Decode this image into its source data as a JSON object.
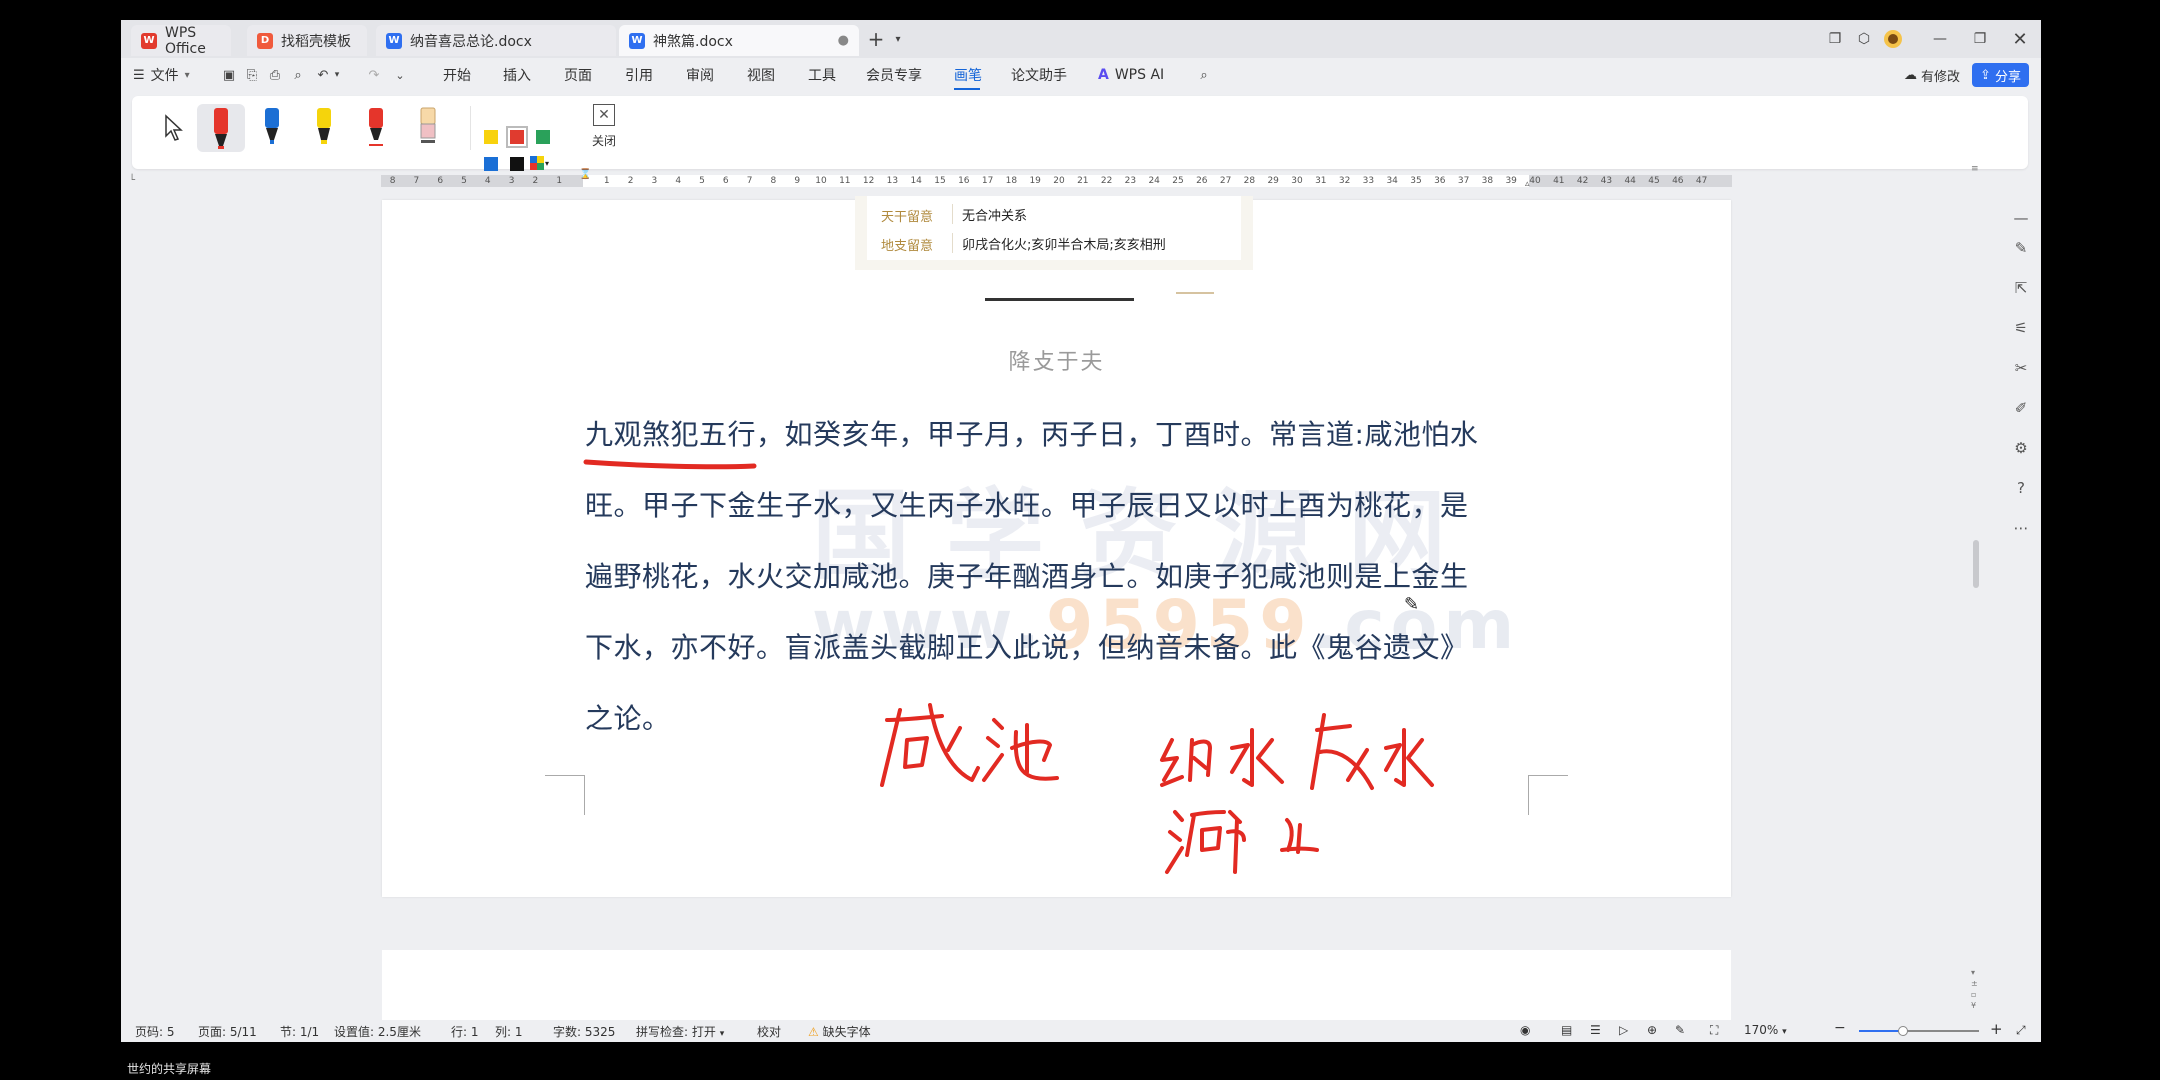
{
  "tabs": [
    {
      "label": "WPS Office",
      "icon": "wps-logo-icon"
    },
    {
      "label": "找稻壳模板",
      "icon": "docer-icon"
    },
    {
      "label": "纳音喜忌总论.docx",
      "icon": "word-doc-icon"
    },
    {
      "label": "神煞篇.docx",
      "icon": "word-doc-icon"
    }
  ],
  "menu": {
    "file": "文件",
    "items": [
      "开始",
      "插入",
      "页面",
      "引用",
      "审阅",
      "视图",
      "工具",
      "会员专享",
      "画笔",
      "论文助手",
      "WPS AI"
    ],
    "active": "画笔",
    "modify": "有修改",
    "share": "分享"
  },
  "pen_toolbar": {
    "close_label": "关闭",
    "colors": [
      "#f8d20d",
      "#e03b2f",
      "#2aa15a",
      "#1a6fd6",
      "#111111"
    ],
    "pens": [
      {
        "name": "red-marker",
        "color": "#e5352b"
      },
      {
        "name": "blue-pen",
        "color": "#1c6fd4"
      },
      {
        "name": "yellow-highlighter",
        "color": "#f5d40c"
      },
      {
        "name": "red-pen",
        "color": "#e5352b"
      },
      {
        "name": "eraser",
        "color": "#f0c0c4"
      }
    ]
  },
  "ruler": {
    "left": [
      "8",
      "7",
      "6",
      "5",
      "4",
      "3",
      "2",
      "1"
    ],
    "right": [
      "1",
      "2",
      "3",
      "4",
      "5",
      "6",
      "7",
      "8",
      "9",
      "10",
      "11",
      "12",
      "13",
      "14",
      "15",
      "16",
      "17",
      "18",
      "19",
      "20",
      "21",
      "22",
      "23",
      "24",
      "25",
      "26",
      "27",
      "28",
      "29",
      "30",
      "31",
      "32",
      "33",
      "34",
      "35",
      "36",
      "37",
      "38",
      "39",
      "40",
      "41",
      "42",
      "43",
      "44",
      "45",
      "46",
      "47"
    ]
  },
  "info_card": {
    "rows": [
      {
        "key": "天干留意",
        "value": "无合冲关系"
      },
      {
        "key": "地支留意",
        "value": "卯戌合化火;亥卯半合木局;亥亥相刑"
      }
    ]
  },
  "document": {
    "chapter_title": "降攴于夫",
    "lines": [
      "九观煞犯五行，如癸亥年，甲子月，丙子日，丁酉时。常言道:咸池怕水",
      "旺。甲子下金生子水，又生丙子水旺。甲子辰日又以时上酉为桃花，是",
      "遍野桃花，水火交加咸池。庚子年酗酒身亡。如庚子犯咸池则是上金生",
      "下水，亦不好。盲派盖头截脚正入此说，但纳音未备。此《鬼谷遗文》",
      "之论。"
    ],
    "watermark_cn": "国学资源网",
    "watermark_url_a": "www.",
    "watermark_url_b": "95959",
    "watermark_url_c": ".com",
    "ink_color": "#e22a22"
  },
  "status": {
    "page_num": "页码: 5",
    "page": "页面: 5/11",
    "section": "节: 1/1",
    "setting": "设置值: 2.5厘米",
    "row": "行: 1",
    "col": "列: 1",
    "words": "字数: 5325",
    "spell": "拼写检查: 打开",
    "proof": "校对",
    "missing_font": "缺失字体",
    "zoom": "170%",
    "zoom_level": 0.37
  },
  "caption": "世约的共享屏幕"
}
